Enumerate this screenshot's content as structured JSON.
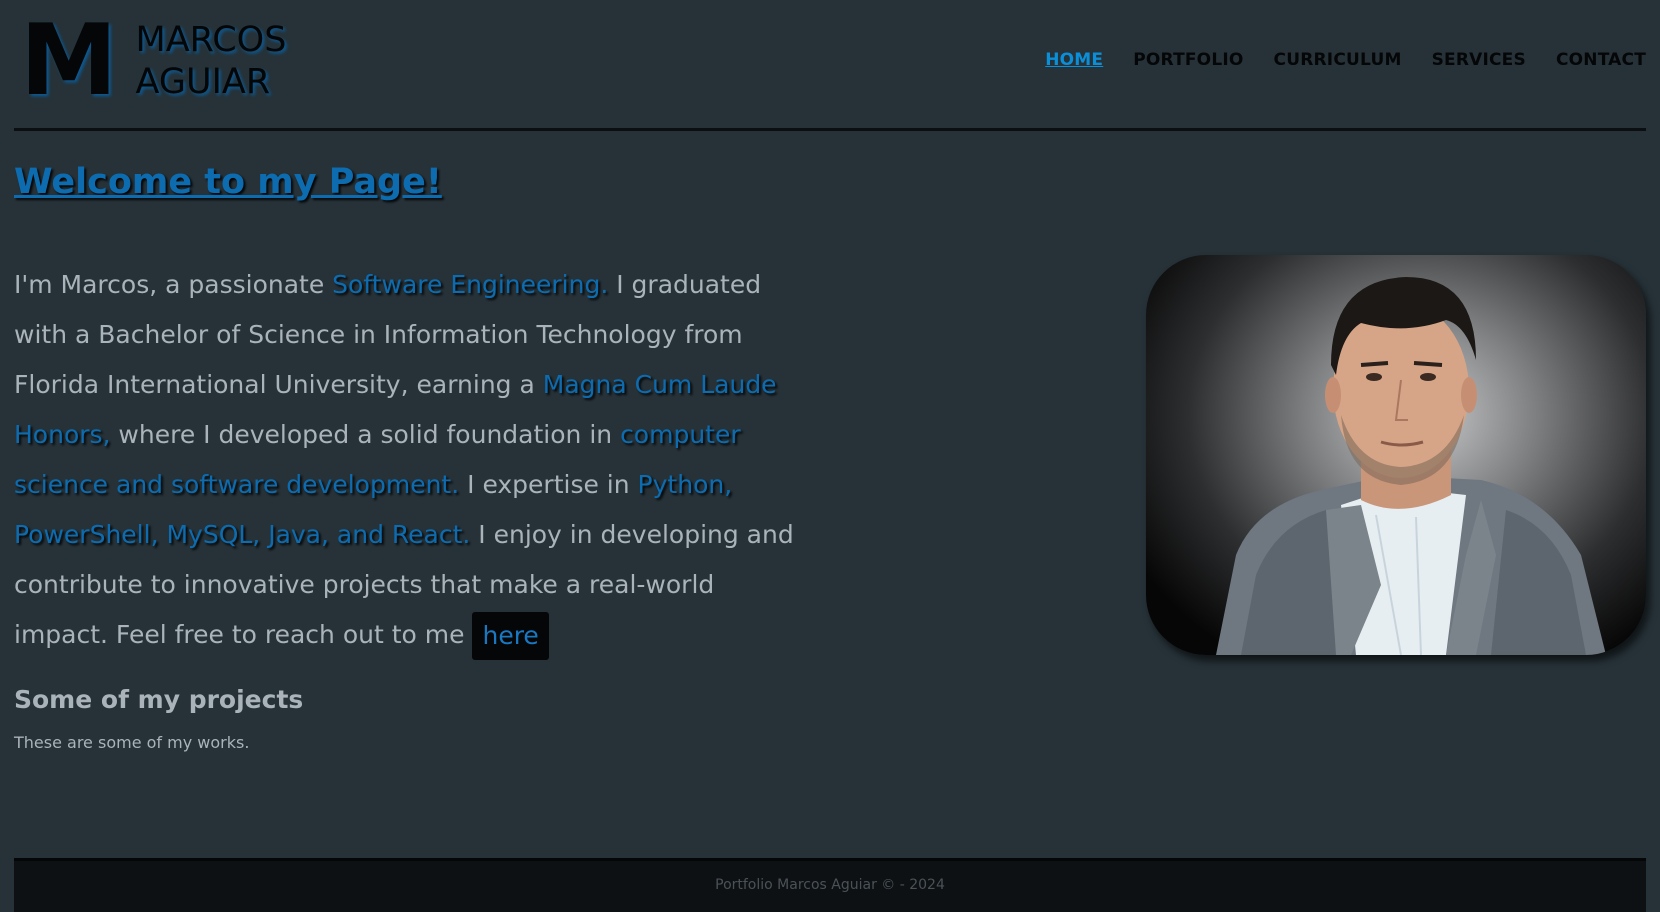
{
  "logo": {
    "letter": "M",
    "first_name": "MARCOS",
    "last_name": "AGUIAR"
  },
  "nav": {
    "items": [
      {
        "label": "HOME",
        "active": true
      },
      {
        "label": "PORTFOLIO",
        "active": false
      },
      {
        "label": "CURRICULUM",
        "active": false
      },
      {
        "label": "SERVICES",
        "active": false
      },
      {
        "label": "CONTACT",
        "active": false
      }
    ]
  },
  "main": {
    "welcome_title": "Welcome to my Page!",
    "intro": {
      "t1": "I'm Marcos, a passionate ",
      "h1": "Software Engineering.",
      "t2": " I graduated with a Bachelor of Science in Information Technology from Florida International University, earning a ",
      "h2": "Magna Cum Laude Honors,",
      "t3": " where I developed a solid foundation in ",
      "h3": "computer science and software development.",
      "t4": " I expertise in ",
      "h4": "Python, PowerShell, MySQL, Java, and React.",
      "t5": " I enjoy in developing and contribute to innovative projects that make a real-world impact. Feel free to reach out to me ",
      "here_link": "here"
    },
    "projects_title": "Some of my projects",
    "projects_subtitle": "These are some of my works."
  },
  "footer": {
    "text": "Portfolio Marcos Aguiar © - 2024"
  },
  "colors": {
    "background": "#263238",
    "accent": "#0d6cb0",
    "nav_active": "#0b8fd8",
    "text": "#a9b3b9"
  }
}
